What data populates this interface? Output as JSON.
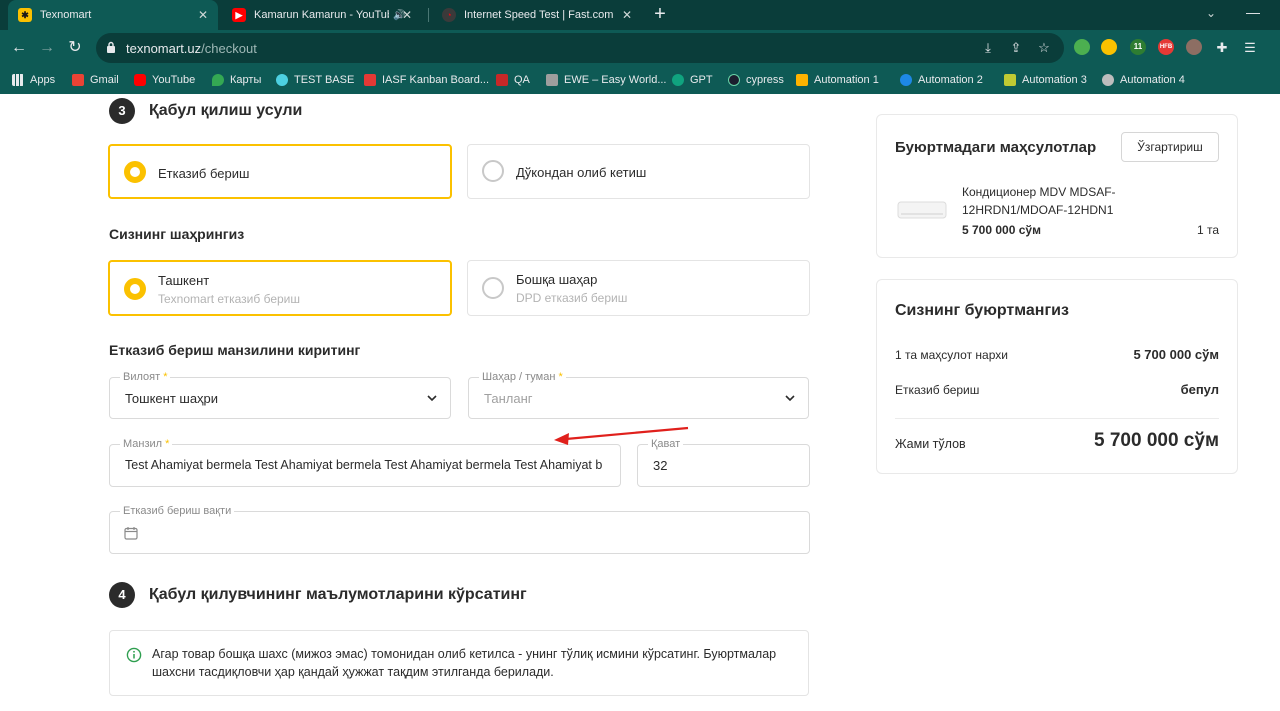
{
  "browser": {
    "tabs": [
      {
        "title": "Texnomart",
        "active": true,
        "favicon_color": "#fbc100"
      },
      {
        "title": "Kamarun Kamarun - YouTube",
        "active": false,
        "favicon_color": "#ff0000",
        "audio": true
      },
      {
        "title": "Internet Speed Test | Fast.com",
        "active": false,
        "favicon_color": "#e50914"
      }
    ],
    "new_tab_label": "+",
    "url_host": "texnomart.uz",
    "url_path": "/checkout",
    "extensions": [
      {
        "name": "ext-1",
        "color": "#4caf50",
        "label": ""
      },
      {
        "name": "ext-2",
        "color": "#fbc100",
        "label": ""
      },
      {
        "name": "ext-3",
        "color": "#2e7d32",
        "label": "11"
      },
      {
        "name": "ext-4",
        "color": "#e53935",
        "label": "HFB"
      },
      {
        "name": "ext-5",
        "color": "#8d6e63",
        "label": ""
      }
    ],
    "bookmarks": [
      {
        "label": "Apps",
        "color": "#e8eaed"
      },
      {
        "label": "Gmail",
        "color": "#ea4335"
      },
      {
        "label": "YouTube",
        "color": "#ff0000"
      },
      {
        "label": "Карты",
        "color": "#34a853"
      },
      {
        "label": "TEST BASE",
        "color": "#4dd0e1"
      },
      {
        "label": "IASF Kanban Board...",
        "color": "#e53935"
      },
      {
        "label": "QA",
        "color": "#c62828"
      },
      {
        "label": "EWE – Easy World...",
        "color": "#9e9e9e"
      },
      {
        "label": "GPT",
        "color": "#10a37f"
      },
      {
        "label": "cypress",
        "color": "#1b1e2e"
      },
      {
        "label": "Automation  1",
        "color": "#ffb300"
      },
      {
        "label": "Automation  2",
        "color": "#1e88e5"
      },
      {
        "label": "Automation 3",
        "color": "#c0ca33"
      },
      {
        "label": "Automation 4",
        "color": "#bdbdbd"
      }
    ]
  },
  "checkout": {
    "step3": {
      "number": "3",
      "title": "Қабул қилиш усули",
      "options": [
        {
          "label": "Етказиб бериш",
          "selected": true
        },
        {
          "label": "Дўкондан олиб кетиш",
          "selected": false
        }
      ]
    },
    "city": {
      "title": "Сизнинг шаҳрингиз",
      "options": [
        {
          "label": "Ташкент",
          "sub": "Texnomart етказиб бериш",
          "selected": true
        },
        {
          "label": "Бошқа шаҳар",
          "sub": "DPD етказиб бериш",
          "selected": false
        }
      ]
    },
    "address": {
      "title": "Етказиб бериш манзилини киритинг",
      "region_label": "Вилоят",
      "region_value": "Тошкент шаҳри",
      "district_label": "Шаҳар / туман",
      "district_placeholder": "Танланг",
      "address_label": "Манзил",
      "address_value": "Test Ahamiyat bermela Test Ahamiyat bermela Test Ahamiyat bermela Test Ahamiyat b",
      "floor_label": "Қават",
      "floor_value": "32",
      "time_label": "Етказиб бериш вақти",
      "required_mark": "*"
    },
    "step4": {
      "number": "4",
      "title": "Қабул қилувчининг маълумотларини кўрсатинг",
      "info": "Агар товар бошқа шахс (мижоз эмас) томонидан олиб кетилса - унинг тўлиқ исмини кўрсатинг. Буюртмалар шахсни тасдиқловчи ҳар қандай ҳужжат тақдим этилганда берилади."
    }
  },
  "sidebar": {
    "products": {
      "title": "Буюртмадаги маҳсулотлар",
      "change_label": "Ўзгартириш",
      "items": [
        {
          "name": "Кондиционер MDV MDSAF-12HRDN1/MDOAF-12HDN1",
          "price": "5 700 000 сўм",
          "qty": "1 та"
        }
      ]
    },
    "summary": {
      "title": "Сизнинг буюртмангиз",
      "rows": [
        {
          "label": "1 та маҳсулот нархи",
          "value": "5 700 000 сўм"
        },
        {
          "label": "Етказиб бериш",
          "value": "бепул"
        }
      ],
      "total_label": "Жами тўлов",
      "total_value": "5 700 000 сўм"
    }
  },
  "colors": {
    "accent": "#fbc100",
    "chrome_dark": "#0a3d3a",
    "chrome": "#0e5a55",
    "annotation": "#e0201c"
  }
}
